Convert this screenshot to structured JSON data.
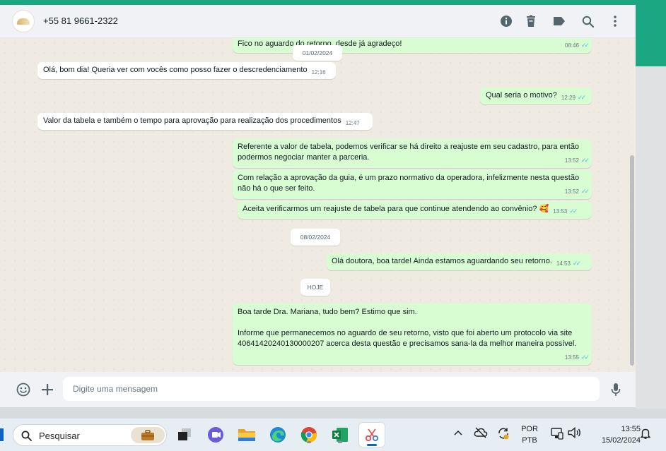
{
  "header": {
    "contact_name": "+55 81 9661-2322",
    "icons": [
      "info-icon",
      "delete-icon",
      "label-icon",
      "search-icon",
      "menu-icon"
    ]
  },
  "chat": {
    "top_partial": {
      "text": "Fico no aguardo do retorno, desde já agradeço!",
      "time": "08:46"
    },
    "date_1": "01/02/2024",
    "m1": {
      "text": "Olá, bom dia! Queria ver com vocês como posso fazer o descredenciamento",
      "time": "12:16"
    },
    "m2": {
      "text": "Qual seria o motivo?",
      "time": "12:29"
    },
    "m3": {
      "text": "Valor da tabela e também o tempo para aprovação para realização dos procedimentos",
      "time": "12:47"
    },
    "m4": {
      "text": "Referente a valor de tabela, podemos verificar se há direito a reajuste em seu cadastro, para então\npodermos negociar manter a parceria.",
      "time": "13:52"
    },
    "m5": {
      "text": "Com relação a aprovação da guia, é um prazo normativo da operadora, infelizmente nesta questão\nnão há o que ser feito.",
      "time": "13:52"
    },
    "m6": {
      "text": "Aceita verificarmos um reajuste de tabela para que continue atendendo ao convênio?",
      "emoji": "🥰",
      "time": "13:53"
    },
    "date_2": "08/02/2024",
    "m7": {
      "text": "Olá doutora, boa tarde! Ainda estamos aguardando seu retorno.",
      "time": "14:53"
    },
    "date_3": "HOJE",
    "m8": {
      "text": "Boa tarde Dra. Mariana, tudo bem? Estimo que sim.\n\nInforme que permanecemos no aguardo de seu retorno, visto que foi aberto um protocolo via site\n40641420240130000207 acerca desta questão e precisamos sana-la da melhor maneira possível.",
      "time": "13:55"
    }
  },
  "composer": {
    "placeholder": "Digite uma mensagem",
    "icons": [
      "emoji-icon",
      "attach-plus-icon",
      "microphone-icon"
    ]
  },
  "taskbar": {
    "search_label": "Pesquisar",
    "apps": [
      "briefcase-icon",
      "task-view-icon",
      "teams-icon",
      "file-explorer-icon",
      "edge-icon",
      "chrome-icon",
      "excel-icon",
      "snipping-tool-icon"
    ],
    "language_1": "POR",
    "language_2": "PTB",
    "time": "13:55",
    "date": "15/02/2024"
  },
  "colors": {
    "accent": "#1aa781",
    "outgoing_bubble": "#d9fdd3",
    "incoming_bubble": "#ffffff",
    "read_ticks": "#53bdeb"
  }
}
